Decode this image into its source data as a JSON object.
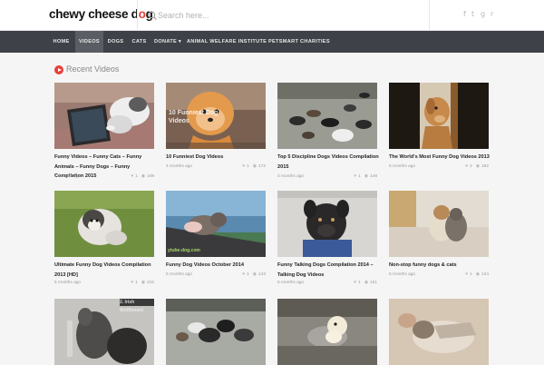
{
  "brand": {
    "prefix": "chewy cheese d",
    "accent_char": "o",
    "suffix": "g",
    "accent_color": "#e8403a"
  },
  "search": {
    "placeholder": "Search here..."
  },
  "social_icons": [
    "facebook-icon",
    "twitter-icon",
    "google-plus-icon",
    "rss-icon"
  ],
  "social_glyphs": [
    "f",
    "t",
    "g",
    "r"
  ],
  "nav": {
    "items": [
      {
        "label": "HOME",
        "active": false
      },
      {
        "label": "VIDEOS",
        "active": true
      },
      {
        "label": "DOGS",
        "active": false
      },
      {
        "label": "CATS",
        "active": false
      },
      {
        "label": "DONATE ▾",
        "active": false
      },
      {
        "label": "ANIMAL WELFARE INSTITUTE",
        "active": false
      },
      {
        "label": "PETSMART CHARITIES",
        "active": false
      }
    ]
  },
  "section": {
    "title": "Recent Videos"
  },
  "videos": [
    {
      "title": "Funny Videos – Funny Cats – Funny Animals – Funny Dogs – Funny Compilation 2015",
      "age": "4 months ago",
      "likes": "1",
      "views": "169"
    },
    {
      "title": "10 Funniest Dog Videos",
      "age": "4 months ago",
      "likes": "1",
      "views": "172",
      "overlay_text": "10 Funniest Dog Videos"
    },
    {
      "title": "Top 5 Discipline Dogs Videos Compilation 2015",
      "age": "4 months ago",
      "likes": "1",
      "views": "148"
    },
    {
      "title": "The World's Most Funny Dog Videos 2013",
      "age": "5 months ago",
      "likes": "2",
      "views": "192"
    },
    {
      "title": "Ultimate Funny Dog Videos Compilation 2013 [HD]",
      "age": "5 months ago",
      "likes": "1",
      "views": "215"
    },
    {
      "title": "Funny Dog Videos October 2014",
      "age": "5 months ago",
      "likes": "1",
      "views": "143"
    },
    {
      "title": "Funny Talking Dogs Compilation 2014 – Talking Dog Videos",
      "age": "5 months ago",
      "likes": "1",
      "views": "151"
    },
    {
      "title": "Non-stop funny dogs & cats",
      "age": "5 months ago",
      "likes": "1",
      "views": "124"
    },
    {
      "title": "",
      "age": "",
      "likes": "",
      "views": "",
      "overlay_text": "2. Irish Wolfhound"
    },
    {
      "title": "",
      "age": "",
      "likes": "",
      "views": ""
    },
    {
      "title": "",
      "age": "",
      "likes": "",
      "views": ""
    },
    {
      "title": "",
      "age": "",
      "likes": "",
      "views": ""
    }
  ]
}
